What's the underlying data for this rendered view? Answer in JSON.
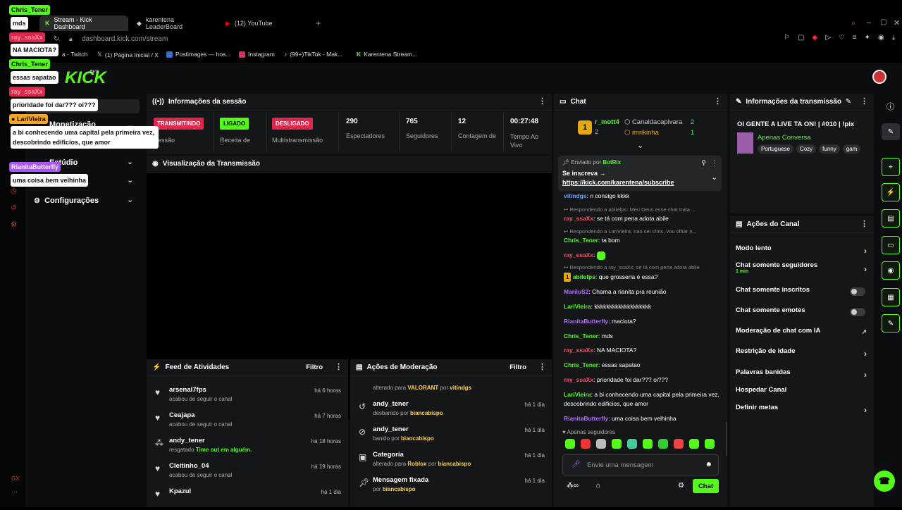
{
  "browser": {
    "tabs": [
      {
        "label": "Stream - Kick Dashboard"
      },
      {
        "label": "karentena LeaderBoard"
      },
      {
        "label": "(12) YouTube"
      }
    ],
    "address": "dashboard.kick.com/stream",
    "bookmarks": [
      "a - Twitch",
      "(1) Página Inicial / X",
      "Postimages — hos...",
      "Instagram",
      "(99+)TikTok - Mak...",
      "Karentena Stream..."
    ]
  },
  "brand": {
    "logo_text": "KICK",
    "beta": "BETA",
    "accent": "#53fc18"
  },
  "sidebar": {
    "items": [
      {
        "label": "Monetização"
      },
      {
        "label": "Estúdio"
      },
      {
        "label": "Configurações"
      }
    ],
    "footer": "GX"
  },
  "session": {
    "title": "Informações da sessão",
    "statuses": [
      {
        "badge": "TRANSMITINDO",
        "label": "Sessão"
      },
      {
        "badge": "LIGADO",
        "label": "Receita de Parceiro"
      },
      {
        "badge": "DESLIGADO",
        "label": "Multistransmissão"
      }
    ],
    "stats": [
      {
        "value": "290",
        "label": "Espectadores"
      },
      {
        "value": "765",
        "label": "Seguidores"
      },
      {
        "value": "12",
        "label": "Contagem de"
      },
      {
        "value": "00:27:48",
        "label": "Tempo Ao Vivo"
      }
    ]
  },
  "preview": {
    "title": "Visualização da Transmissão"
  },
  "feed": {
    "title": "Feed de Atividades",
    "filter": "Filtro",
    "items": [
      {
        "name": "arsenal7fps",
        "sub": "acabou de seguir o canal",
        "time": "há 6 horas"
      },
      {
        "name": "Ceajapa",
        "sub": "acabou de seguir o canal",
        "time": "há 7 horas"
      },
      {
        "name": "andy_tener",
        "sub": "resgatado",
        "sub_extra": "Time out em alguém.",
        "time": "há 18 horas"
      },
      {
        "name": "Cleitinho_04",
        "sub": "acabou de seguir o canal",
        "time": "há 19 horas"
      },
      {
        "name": "Kpazul",
        "sub": "",
        "time": "há 1 dia"
      }
    ]
  },
  "moderation": {
    "title": "Ações de Moderação",
    "filter": "Filtro",
    "top_partial": {
      "text": "alterado para",
      "a": "VALORANT",
      "mid": "por",
      "b": "vitindgs"
    },
    "items": [
      {
        "name": "andy_tener",
        "sub": "desbanido por",
        "by": "biancabispo",
        "time": "há 1 dia"
      },
      {
        "name": "andy_tener",
        "sub": "banido por",
        "by": "biancabispo",
        "time": "há 1 dia"
      },
      {
        "name": "Categoria",
        "sub": "alterado para",
        "val": "Roblox",
        "mid": "por",
        "by": "biancabispo",
        "time": "há 1 dia"
      },
      {
        "name": "Mensagem fixada",
        "sub": "por",
        "by": "biancabispo",
        "time": "há 1 dia"
      }
    ]
  },
  "chat": {
    "title": "Chat",
    "leaders": [
      {
        "rank": "1",
        "name": "r_mott4",
        "count": "2"
      },
      {
        "name": "Canaldacapivara",
        "count": "2"
      },
      {
        "name": "imrikinha",
        "count": "1"
      }
    ],
    "pinned": {
      "sent_by": "Enviado por",
      "bot": "BotRix",
      "text": "Se inscreva →",
      "link": "https://kick.com/karentena/subscribe"
    },
    "messages": [
      {
        "user": "vitindgs",
        "text": "n consigo kkkk"
      },
      {
        "reply": "Respondendo a abilefps: Meu Deus esse chat trata ...",
        "user": "ray_ssaXx",
        "text": "se tá com pena adota abile"
      },
      {
        "reply": "Respondendo a LariVieira: nao sei chris, vou olhar n...",
        "user": "Chris_Tener",
        "text": "ta bom"
      },
      {
        "user": "ray_ssaXx",
        "text": ""
      },
      {
        "reply": "Respondendo a ray_ssaXx: se tá com pena adota abile",
        "user": "abilefps",
        "text": "que grosseria é essa?"
      },
      {
        "user": "MariluS2",
        "text": "Chama a rianita pra reunião"
      },
      {
        "user": "LariVieira",
        "text": "kkkkkkkkkkkkkkkkkkk"
      },
      {
        "user": "RianitaButterfly",
        "text": "maciota?"
      },
      {
        "user": "Chris_Tener",
        "text": "mds"
      },
      {
        "user": "ray_ssaXx",
        "text": "NA MACIOTA?"
      },
      {
        "user": "Chris_Tener",
        "text": "essas sapatao"
      },
      {
        "user": "ray_ssaXx",
        "text": "prioridade foi dar??? oi???"
      },
      {
        "user": "LariVieira",
        "text": "a bi conhecendo uma capital pela primeira vez, descobrindo edificios, que amor"
      },
      {
        "user": "RianitaButterfly",
        "text": "uma coisa bem velhinha"
      }
    ],
    "followers_only": "Apenas seguidores",
    "input_placeholder": "Envie uma mensagem",
    "send": "Chat"
  },
  "broadcast": {
    "title": "Informações da transmissão",
    "stream_title": "OI GENTE A LIVE TA ON! | #010 | !pix",
    "category": "Apenas Conversa",
    "tags": [
      "Portuguese",
      "Cozy",
      "funny",
      "gam"
    ]
  },
  "channel_actions": {
    "title": "Ações do Canal",
    "items": [
      {
        "label": "Modo lento",
        "kind": "chevron"
      },
      {
        "label": "Chat somente seguidores",
        "sub": "1 min",
        "kind": "chevron"
      },
      {
        "label": "Chat somente inscritos",
        "kind": "toggle"
      },
      {
        "label": "Chat somente emotes",
        "kind": "toggle"
      },
      {
        "label": "Moderação de chat com IA",
        "kind": "external"
      },
      {
        "label": "Restrição de idade",
        "kind": "chevron"
      },
      {
        "label": "Palavras banidas",
        "kind": "chevron"
      },
      {
        "label": "Hospedar Canal",
        "kind": "none"
      },
      {
        "label": "Definir metas",
        "kind": "chevron"
      }
    ]
  },
  "overlay": [
    {
      "name": "Chris_Tener",
      "msg": "mds"
    },
    {
      "name": "ray_ssaXx",
      "msg": "NA MACIOTA?"
    },
    {
      "name": "Chris_Tener",
      "msg": "essas sapatao"
    },
    {
      "name": "ray_ssaXx",
      "msg": "prioridade foi dar??? oi???"
    },
    {
      "name": "LariVieira",
      "msg": "a bi conhecendo uma capital pela primeira vez, descobrindo edificios, que amor"
    },
    {
      "name": "RianitaButterfly",
      "msg": "uma coisa bem velhinha"
    }
  ]
}
